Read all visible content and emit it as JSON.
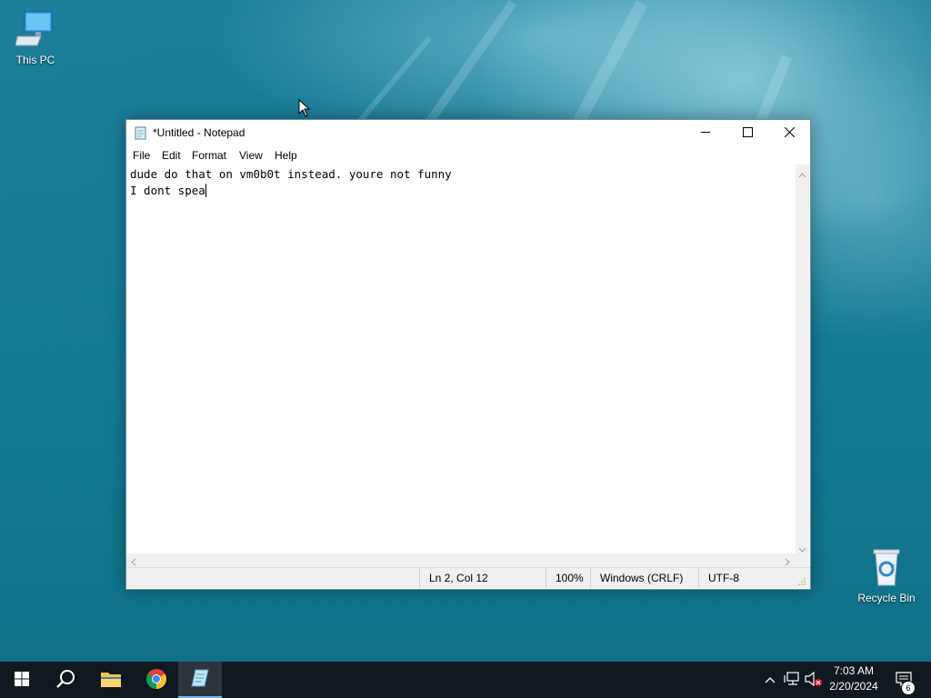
{
  "desktop": {
    "icons": [
      {
        "label": "This PC",
        "icon": "computer-icon"
      },
      {
        "label": "Recycle Bin",
        "icon": "recycle-bin-icon"
      }
    ]
  },
  "notepad": {
    "title": "*Untitled - Notepad",
    "menu": [
      "File",
      "Edit",
      "Format",
      "View",
      "Help"
    ],
    "content": [
      "dude do that on vm0b0t instead. youre not funny",
      "I dont spea"
    ],
    "status": {
      "position": "Ln 2, Col 12",
      "zoom": "100%",
      "line_ending": "Windows (CRLF)",
      "encoding": "UTF-8"
    }
  },
  "taskbar": {
    "apps": [
      "start-icon",
      "search-icon",
      "file-explorer-icon",
      "chrome-icon",
      "notepad-icon"
    ],
    "clock": {
      "time": "7:03 AM",
      "date": "2/20/2024"
    },
    "notification_count": "6"
  },
  "colors": {
    "accent": "#76b9ed",
    "taskbar": "#101820",
    "desktop": "#1a7d96"
  }
}
